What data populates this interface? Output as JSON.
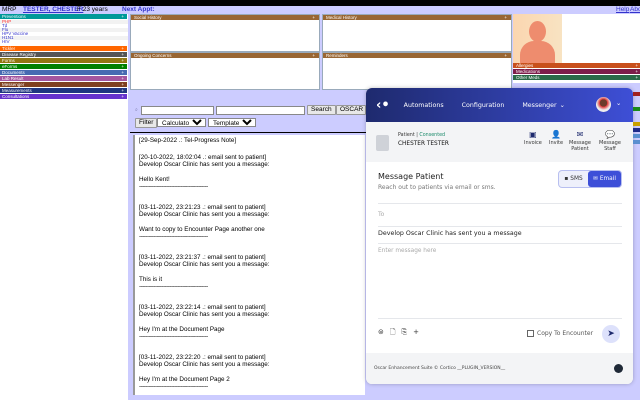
{
  "header": {
    "mrp": "MRP",
    "patient_link": "TESTER, CHESTER",
    "patient_info": "F 23 years",
    "next_appt": "Next Appt:",
    "help": "Help",
    "about": "Abo"
  },
  "left_nav": {
    "preventions": {
      "label": "Preventions",
      "color": "#009999",
      "items": [
        {
          "label": "PHP",
          "color": "#ff3333"
        },
        {
          "label": "Td",
          "color": "#3333cc"
        },
        {
          "label": "Flu",
          "color": "#3333cc"
        },
        {
          "label": "HPV Vaccine",
          "color": "#3333cc"
        },
        {
          "label": "H1N1",
          "color": "#3333cc"
        },
        {
          "label": "HIV",
          "color": "#3333cc"
        }
      ]
    },
    "sections": [
      {
        "label": "Tickler",
        "color": "#ff6600"
      },
      {
        "label": "Disease Registry",
        "color": "#555555"
      },
      {
        "label": "Forms",
        "color": "#917611"
      },
      {
        "label": "eForms",
        "color": "#008000"
      },
      {
        "label": "Documents",
        "color": "#476bb2"
      },
      {
        "label": "Lab Result",
        "color": "#a4569f"
      },
      {
        "label": "Messenger",
        "color": "#804020"
      },
      {
        "label": "Measurements",
        "color": "#1f3680"
      },
      {
        "label": "Consultations",
        "color": "#6633cc"
      }
    ]
  },
  "summary": {
    "social_history": "Social History",
    "medical_history": "Medical History",
    "ongoing_concerns": "Ongoing Concerns",
    "reminders": "Reminders",
    "plus": "+"
  },
  "right_bars": [
    {
      "label": "Allergies",
      "color": "#c8501c"
    },
    {
      "label": "Medications",
      "color": "#7d1d4a"
    },
    {
      "label": "Other Meds",
      "color": "#2a6a48"
    }
  ],
  "toolbar": {
    "search_label": "Search",
    "oscar_label": "OSCAR S",
    "filter_label": "Filter",
    "calculators": "Calculators",
    "templates": "Templates"
  },
  "notes": [
    {
      "lines": [
        "[29-Sep-2022 .: Tel-Progress Note]"
      ]
    },
    {
      "lines": [
        "[20-10-2022, 18:02:04 .: email sent to patient]",
        "Develop Oscar Clinic has sent you a message:",
        "",
        "Hello Kent!"
      ]
    },
    {
      "lines": [
        "[03-11-2022, 23:21:23 .: email sent to patient]",
        "Develop Oscar Clinic has sent you a message:",
        "",
        "Want to copy to Encounter Page another one"
      ]
    },
    {
      "lines": [
        "[03-11-2022, 23:21:37 .: email sent to patient]",
        "Develop Oscar Clinic has sent you a message:",
        "",
        "This is it"
      ]
    },
    {
      "lines": [
        "[03-11-2022, 23:22:14 .: email sent to patient]",
        "Develop Oscar Clinic has sent you a message:",
        "",
        "Hey I'm at the Document Page"
      ]
    },
    {
      "lines": [
        "[03-11-2022, 23:22:20 .: email sent to patient]",
        "Develop Oscar Clinic has sent you a message:",
        "",
        "Hey I'm at the Document Page 2"
      ]
    }
  ],
  "note_divider": "-------------------------------------------",
  "popup": {
    "nav": [
      "Automations",
      "Configuration",
      "Messenger"
    ],
    "patient_label": "Patient",
    "consent": "Consented",
    "patient_name": "CHESTER TESTER",
    "actions": [
      {
        "label": "Invoice",
        "icon": "invoice-icon"
      },
      {
        "label": "Invite",
        "icon": "user-plus-icon"
      },
      {
        "label": "Message\nPatient",
        "icon": "envelope-icon"
      },
      {
        "label": "Message\nStaff",
        "icon": "chat-icon"
      }
    ],
    "title": "Message Patient",
    "subtitle": "Reach out to patients via email or sms.",
    "sms": "SMS",
    "email": "Email",
    "to_placeholder": "To",
    "subject": "Develop Oscar Clinic has sent you a message",
    "body_placeholder": "Enter message here",
    "copy_to_encounter": "Copy To Encounter",
    "footer": "Oscar Enhancement Suite © Cortico __PLUGIN_VERSION__",
    "accent": "#3d4fd8"
  }
}
